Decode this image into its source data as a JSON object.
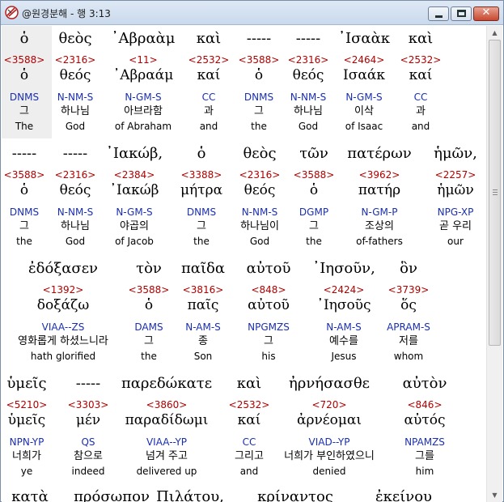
{
  "window": {
    "title": "@원경분해 - 행 3:13",
    "icon": "app-logo-icon",
    "controls": [
      "minimize",
      "maximize",
      "close"
    ],
    "close_glyph": "✕"
  },
  "scrollbar": {
    "up_glyph": "▲",
    "down_glyph": "▼",
    "grip_icon": "scroll-grip-icon"
  },
  "rows": [
    {
      "words": [
        {
          "greek": "ὁ",
          "strong": "<3588>",
          "lemma": "ὁ",
          "parse": "DNMS",
          "korean": "그",
          "english": "The"
        },
        {
          "greek": "θεὸς",
          "strong": "<2316>",
          "lemma": "θεός",
          "parse": "N-NM-S",
          "korean": "하나님",
          "english": "God"
        },
        {
          "greek": "᾿Αβραὰμ",
          "strong": "<11>",
          "lemma": "᾿Αβραάμ",
          "parse": "N-GM-S",
          "korean": "아브라함",
          "english": "of Abraham"
        },
        {
          "greek": "καὶ",
          "strong": "<2532>",
          "lemma": "καί",
          "parse": "CC",
          "korean": "과",
          "english": "and"
        },
        {
          "greek": "-----",
          "strong": "<3588>",
          "lemma": "ὁ",
          "parse": "DNMS",
          "korean": "그",
          "english": "the"
        },
        {
          "greek": "-----",
          "strong": "<2316>",
          "lemma": "θεός",
          "parse": "N-NM-S",
          "korean": "하나님",
          "english": "God"
        },
        {
          "greek": "᾿Ισαὰκ",
          "strong": "<2464>",
          "lemma": "Ισαάκ",
          "parse": "N-GM-S",
          "korean": "이삭",
          "english": "of Isaac"
        },
        {
          "greek": "καὶ",
          "strong": "<2532>",
          "lemma": "καί",
          "parse": "CC",
          "korean": "과",
          "english": "and"
        }
      ]
    },
    {
      "words": [
        {
          "greek": "-----",
          "strong": "<3588>",
          "lemma": "ὁ",
          "parse": "DNMS",
          "korean": "그",
          "english": "the"
        },
        {
          "greek": "-----",
          "strong": "<2316>",
          "lemma": "θεός",
          "parse": "N-NM-S",
          "korean": "하나님",
          "english": "God"
        },
        {
          "greek": "᾿Ιακώβ,",
          "strong": "<2384>",
          "lemma": "᾿Ιακώβ",
          "parse": "N-GM-S",
          "korean": "야곱의",
          "english": "of Jacob"
        },
        {
          "greek": "ὁ",
          "strong": "<3388>",
          "lemma": "μήτρα",
          "parse": "DNMS",
          "korean": "그",
          "english": "the"
        },
        {
          "greek": "θεὸς",
          "strong": "<2316>",
          "lemma": "θεός",
          "parse": "N-NM-S",
          "korean": "하나님이",
          "english": "God"
        },
        {
          "greek": "τῶν",
          "strong": "<3588>",
          "lemma": "ὁ",
          "parse": "DGMP",
          "korean": "그",
          "english": "the"
        },
        {
          "greek": "πατέρων",
          "strong": "<3962>",
          "lemma": "πατήρ",
          "parse": "N-GM-P",
          "korean": "조상의",
          "english": "of-fathers"
        },
        {
          "greek": "ἡμῶν,",
          "strong": "<2257>",
          "lemma": "ἡμῶν",
          "parse": "NPG-XP",
          "korean": "곧 우리",
          "english": "our"
        }
      ]
    },
    {
      "words": [
        {
          "greek": "ἐδόξασεν",
          "strong": "<1392>",
          "lemma": "δοξάζω",
          "parse": "VIAA--ZS",
          "korean": "영화롭게 하셨느니라",
          "english": "hath glorified"
        },
        {
          "greek": "τὸν",
          "strong": "<3588>",
          "lemma": "ὁ",
          "parse": "DAMS",
          "korean": "그",
          "english": "the"
        },
        {
          "greek": "παῖδα",
          "strong": "<3816>",
          "lemma": "παῖς",
          "parse": "N-AM-S",
          "korean": "종",
          "english": "Son"
        },
        {
          "greek": "αὐτοῦ",
          "strong": "<848>",
          "lemma": "αὐτοῦ",
          "parse": "NPGMZS",
          "korean": "그",
          "english": "his"
        },
        {
          "greek": "᾿Ιησοῦν,",
          "strong": "<2424>",
          "lemma": "᾿Ιησοῦς",
          "parse": "N-AM-S",
          "korean": "예수를",
          "english": "Jesus"
        },
        {
          "greek": "ὃν",
          "strong": "<3739>",
          "lemma": "ὅς",
          "parse": "APRAM-S",
          "korean": "저를",
          "english": "whom"
        }
      ]
    },
    {
      "words": [
        {
          "greek": "ὑμεῖς",
          "strong": "<5210>",
          "lemma": "ὑμεῖς",
          "parse": "NPN-YP",
          "korean": "너희가",
          "english": "ye"
        },
        {
          "greek": "-----",
          "strong": "<3303>",
          "lemma": "μέν",
          "parse": "QS",
          "korean": "참으로",
          "english": "indeed"
        },
        {
          "greek": "παρεδώκατε",
          "strong": "<3860>",
          "lemma": "παραδίδωμι",
          "parse": "VIAA--YP",
          "korean": "넘겨 주고",
          "english": "delivered up"
        },
        {
          "greek": "καὶ",
          "strong": "<2532>",
          "lemma": "καί",
          "parse": "CC",
          "korean": "그리고",
          "english": "and"
        },
        {
          "greek": "ἠρνήσασθε",
          "strong": "<720>",
          "lemma": "ἀρνέομαι",
          "parse": "VIAD--YP",
          "korean": "너희가 부인하였으니",
          "english": "denied"
        },
        {
          "greek": "αὐτὸν",
          "strong": "<846>",
          "lemma": "αὐτός",
          "parse": "NPAMZS",
          "korean": "그를",
          "english": "him"
        }
      ]
    },
    {
      "words": [
        {
          "greek": "κατὰ"
        },
        {
          "greek": "πρόσωπον"
        },
        {
          "greek": "Πιλάτου,"
        },
        {
          "greek": "κρίναντος"
        },
        {
          "greek": "ἐκείνου"
        }
      ]
    }
  ]
}
